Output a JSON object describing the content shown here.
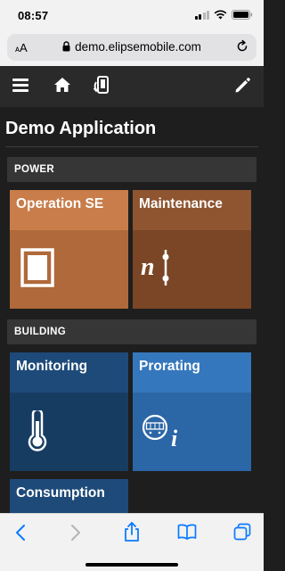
{
  "status_bar": {
    "time": "08:57"
  },
  "browser": {
    "text_size_label": "AA",
    "url": "demo.elipsemobile.com"
  },
  "app": {
    "page_title": "Demo Application",
    "sections": [
      {
        "header": "POWER",
        "tiles": [
          {
            "label": "Operation SE",
            "icon": "single-line-diagram-icon"
          },
          {
            "label": "Maintenance",
            "icon": "breaker-maintenance-icon"
          }
        ]
      },
      {
        "header": "BUILDING",
        "tiles": [
          {
            "label": "Monitoring",
            "icon": "thermometer-icon"
          },
          {
            "label": "Prorating",
            "icon": "meter-info-icon"
          },
          {
            "label": "Consumption"
          }
        ]
      }
    ]
  },
  "colors": {
    "power_tile_top": "#c87d4a",
    "power_tile_bottom": "#b0693a",
    "maint_tile_top": "#8f5530",
    "maint_tile_bottom": "#7a4626",
    "monitoring_top": "#1d4a78",
    "monitoring_bottom": "#173c62",
    "prorating_top": "#3577bd",
    "prorating_bottom": "#2b66a6",
    "ios_blue": "#0a7aff"
  }
}
